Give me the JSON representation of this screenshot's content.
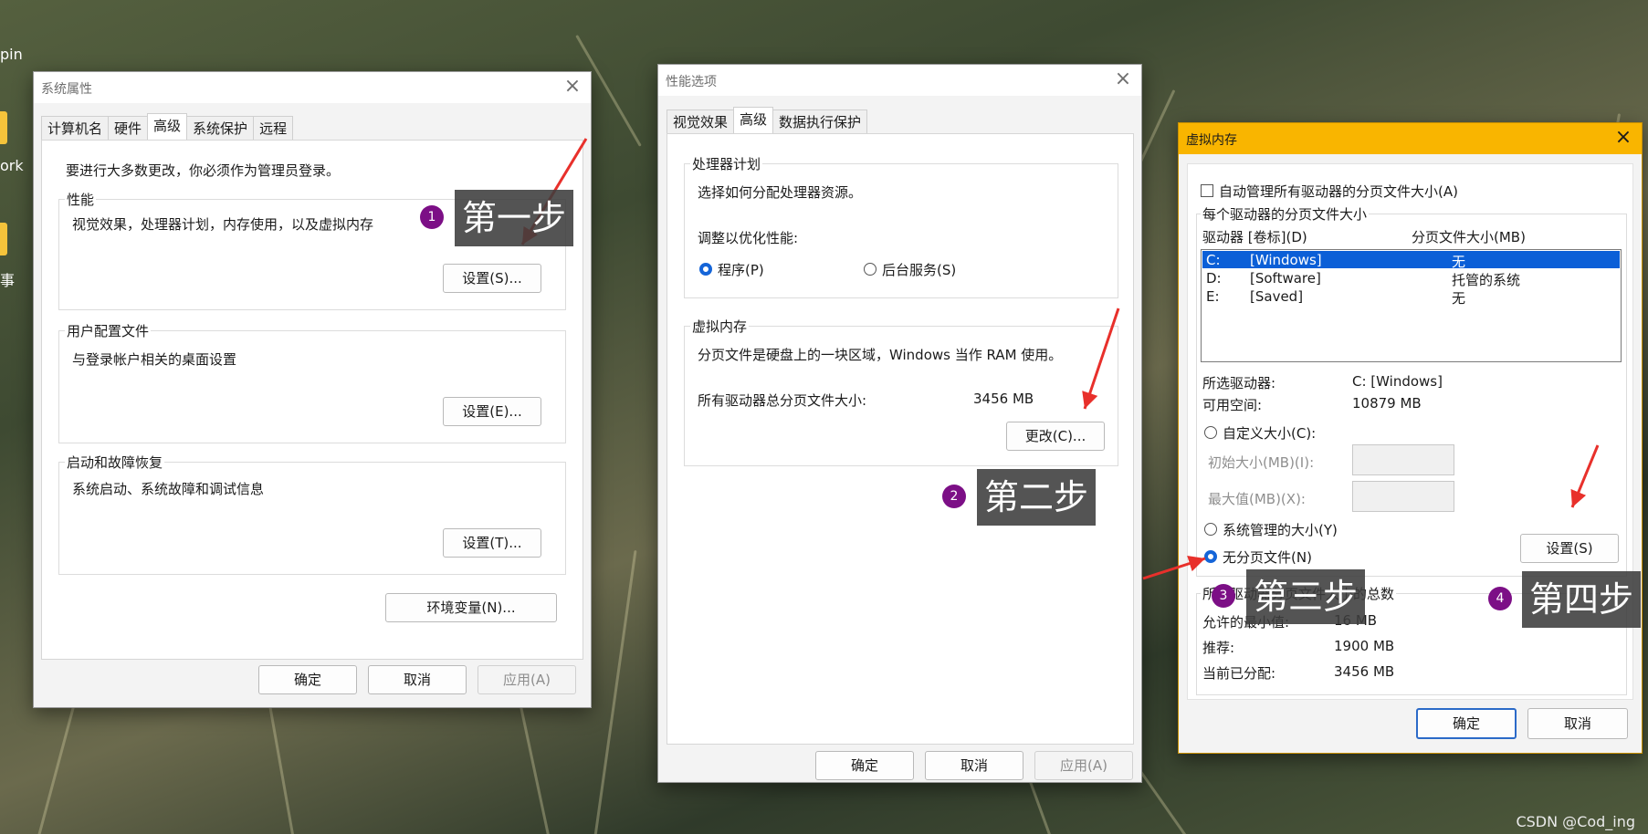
{
  "desktop": {
    "edge_labels": [
      "pin",
      "ork",
      "事"
    ],
    "watermark": "CSDN @Cod_ing"
  },
  "sys_props": {
    "title": "系统属性",
    "tabs": [
      {
        "label": "计算机名"
      },
      {
        "label": "硬件"
      },
      {
        "label": "高级"
      },
      {
        "label": "系统保护"
      },
      {
        "label": "远程"
      }
    ],
    "notice": "要进行大多数更改，你必须作为管理员登录。",
    "performance": {
      "label": "性能",
      "desc": "视觉效果，处理器计划，内存使用，以及虚拟内存",
      "button": "设置(S)..."
    },
    "profile": {
      "label": "用户配置文件",
      "desc": "与登录帐户相关的桌面设置",
      "button": "设置(E)..."
    },
    "startup": {
      "label": "启动和故障恢复",
      "desc": "系统启动、系统故障和调试信息",
      "button": "设置(T)..."
    },
    "env_button": "环境变量(N)...",
    "ok": "确定",
    "cancel": "取消",
    "apply": "应用(A)"
  },
  "perf_opts": {
    "title": "性能选项",
    "tabs": [
      {
        "label": "视觉效果"
      },
      {
        "label": "高级"
      },
      {
        "label": "数据执行保护"
      }
    ],
    "cpu": {
      "label": "处理器计划",
      "desc": "选择如何分配处理器资源。",
      "optimize_label": "调整以优化性能:",
      "opt_programs": "程序(P)",
      "opt_background": "后台服务(S)"
    },
    "vm": {
      "label": "虚拟内存",
      "desc": "分页文件是硬盘上的一块区域，Windows 当作 RAM 使用。",
      "total_label": "所有驱动器总分页文件大小:",
      "total_value": "3456 MB",
      "change_button": "更改(C)..."
    },
    "ok": "确定",
    "cancel": "取消",
    "apply": "应用(A)"
  },
  "virt_mem": {
    "title": "虚拟内存",
    "auto_manage": "自动管理所有驱动器的分页文件大小(A)",
    "per_drive_label": "每个驱动器的分页文件大小",
    "col_drive": "驱动器 [卷标](D)",
    "col_size": "分页文件大小(MB)",
    "drives": [
      {
        "letter": "C:",
        "label": "[Windows]",
        "size": "无"
      },
      {
        "letter": "D:",
        "label": "[Software]",
        "size": "托管的系统"
      },
      {
        "letter": "E:",
        "label": "[Saved]",
        "size": "无"
      }
    ],
    "selected_label": "所选驱动器:",
    "selected_value": "C:  [Windows]",
    "free_label": "可用空间:",
    "free_value": "10879 MB",
    "custom_size": "自定义大小(C):",
    "initial_label": "初始大小(MB)(I):",
    "max_label": "最大值(MB)(X):",
    "system_managed": "系统管理的大小(Y)",
    "no_paging": "无分页文件(N)",
    "set_button": "设置(S)",
    "total_group_label": "所有驱动器分页文件大小的总数",
    "min_label": "允许的最小值:",
    "min_value": "16 MB",
    "recommended_label": "推荐:",
    "recommended_value": "1900 MB",
    "current_label": "当前已分配:",
    "current_value": "3456 MB",
    "ok": "确定",
    "cancel": "取消"
  },
  "annotations": {
    "step1": {
      "number": "1",
      "text": "第一步"
    },
    "step2": {
      "number": "2",
      "text": "第二步"
    },
    "step3": {
      "number": "3",
      "text": "第三步"
    },
    "step4": {
      "number": "4",
      "text": "第四步"
    },
    "arrow_color": "#e8302b"
  },
  "colors": {
    "vm_titlebar": "#f9b500",
    "selection": "#0b5fd7",
    "step_badge": "#7c0f86"
  }
}
